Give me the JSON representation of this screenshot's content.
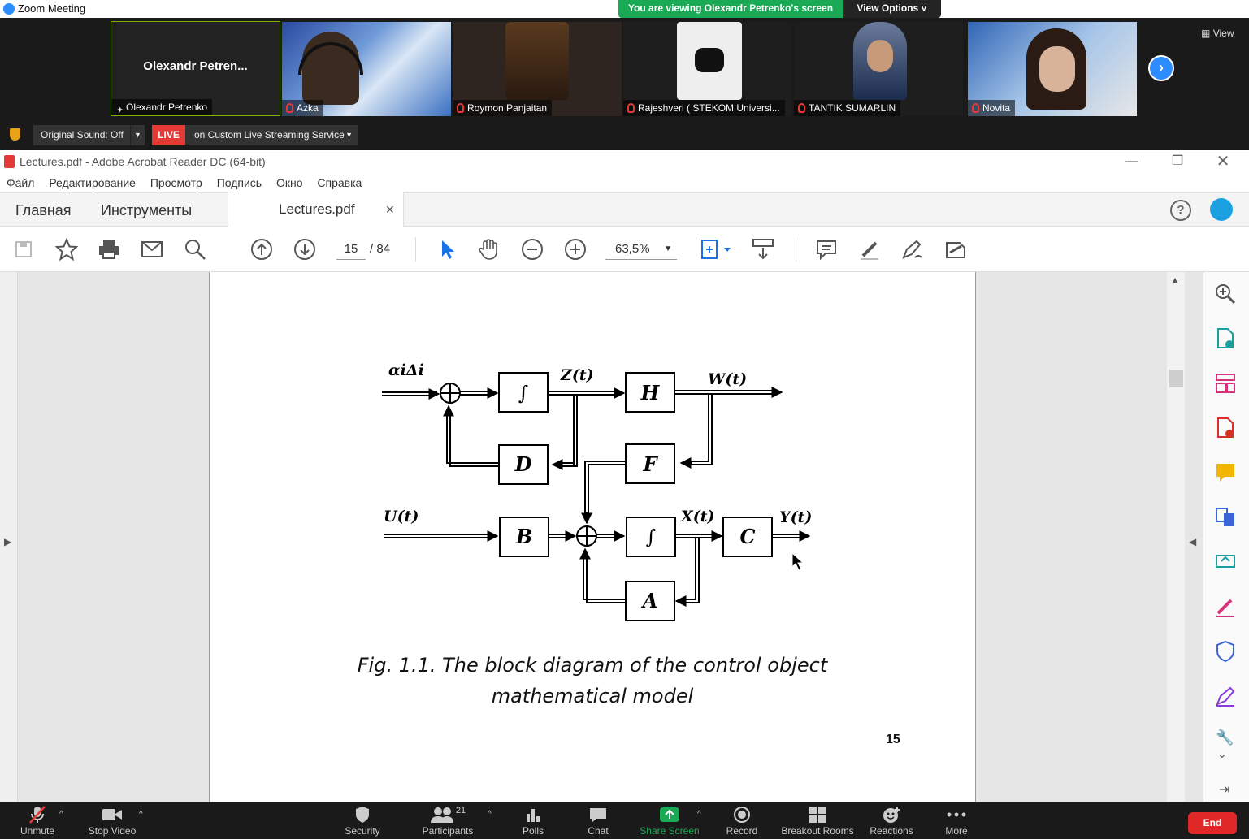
{
  "zoom": {
    "window_title": "Zoom Meeting",
    "viewing_banner": "You are viewing Olexandr Petrenko's screen",
    "view_options": "View Options",
    "view_button": "View",
    "active_speaker_display": "Olexandr  Petren...",
    "participants": [
      {
        "name": "Olexandr Petrenko"
      },
      {
        "name": "Azka"
      },
      {
        "name": "Roymon Panjaitan"
      },
      {
        "name": "Rajeshveri ( STEKOM Universi..."
      },
      {
        "name": "TANTIK SUMARLIN"
      },
      {
        "name": "Novita"
      }
    ],
    "original_sound": "Original Sound: Off",
    "live_badge": "LIVE",
    "live_service": "on Custom Live Streaming Service",
    "bottom_bar": {
      "unmute": "Unmute",
      "stop_video": "Stop Video",
      "security": "Security",
      "participants": "Participants",
      "participant_count": "21",
      "polls": "Polls",
      "chat": "Chat",
      "share_screen": "Share Screen",
      "record": "Record",
      "breakout_rooms": "Breakout Rooms",
      "reactions": "Reactions",
      "more": "More",
      "end": "End"
    }
  },
  "acrobat": {
    "window_title": "Lectures.pdf - Adobe Acrobat Reader DC (64-bit)",
    "menu": [
      "Файл",
      "Редактирование",
      "Просмотр",
      "Подпись",
      "Окно",
      "Справка"
    ],
    "tabs": {
      "home": "Главная",
      "tools": "Инструменты",
      "document": "Lectures.pdf"
    },
    "page_current": "15",
    "page_total": "/   84",
    "zoom_level": "63,5%"
  },
  "document": {
    "diagram_labels": {
      "alpha_delta": "αiΔi",
      "z": "Z(t)",
      "w": "W(t)",
      "u": "U(t)",
      "x": "X(t)",
      "y": "Y(t)",
      "block_int1": "∫",
      "block_h": "H",
      "block_d": "D",
      "block_f": "F",
      "block_b": "B",
      "block_int2": "∫",
      "block_c": "C",
      "block_a": "A"
    },
    "caption_line1": "Fig. 1.1. The block diagram of the control object",
    "caption_line2": "mathematical model",
    "page_number": "15"
  },
  "colors": {
    "accent_blue": "#2d8cff",
    "live_red": "#e53935",
    "viewing_green": "#1aaa55",
    "end_red": "#e02828"
  }
}
